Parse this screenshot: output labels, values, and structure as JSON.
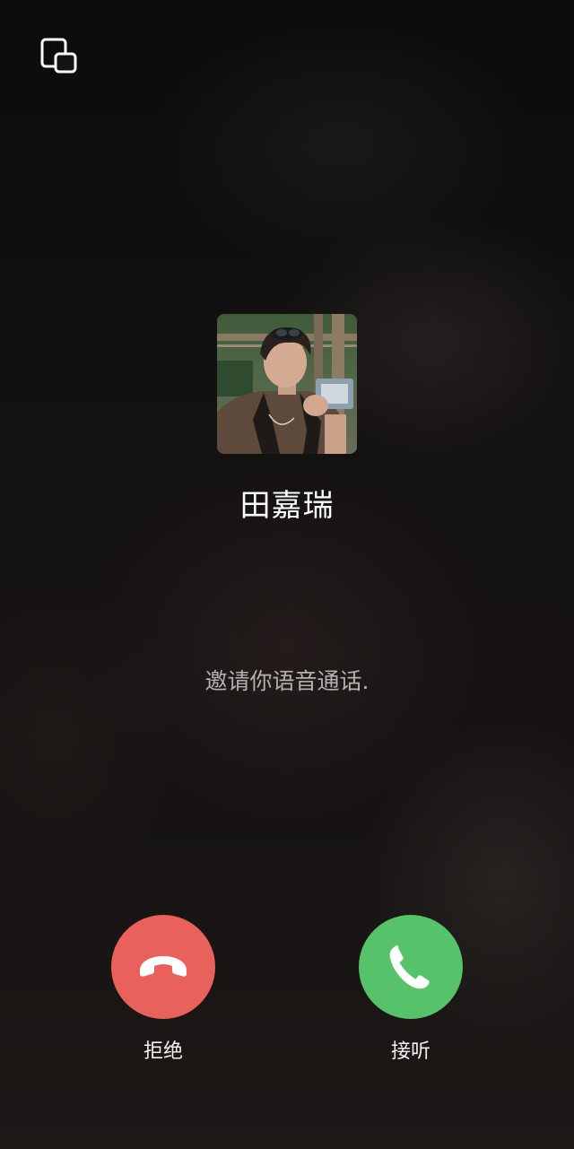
{
  "caller": {
    "name": "田嘉瑞",
    "avatar_alt": "caller-avatar-photo"
  },
  "call": {
    "status_text": "邀请你语音通话."
  },
  "actions": {
    "decline_label": "拒绝",
    "accept_label": "接听"
  },
  "icons": {
    "minimize": "floating-window-icon",
    "decline": "phone-hangup-icon",
    "accept": "phone-icon"
  },
  "colors": {
    "decline": "#e8615c",
    "accept": "#56c26a",
    "status_text": "#b4b0ae"
  }
}
